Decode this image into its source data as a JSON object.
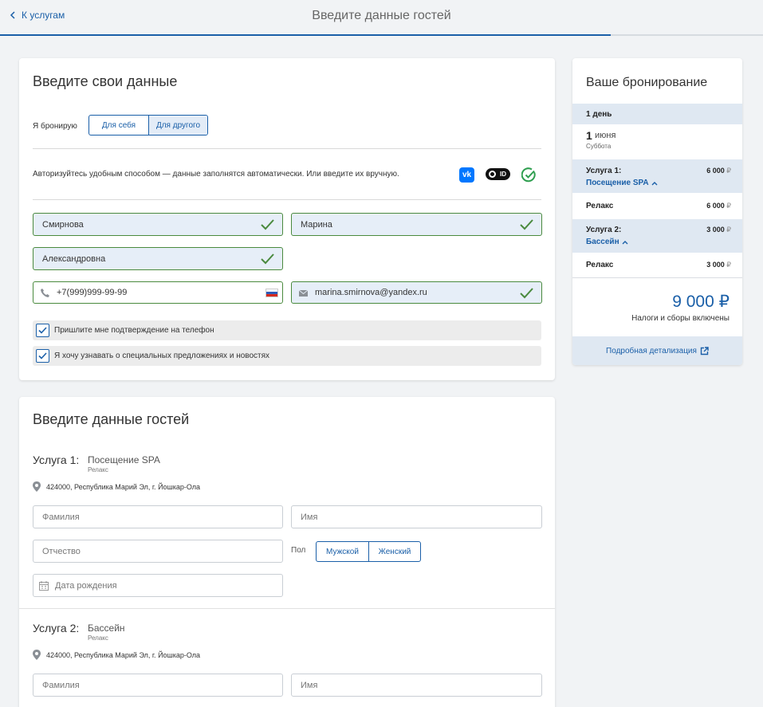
{
  "header": {
    "back_label": "К услугам",
    "title": "Введите данные гостей",
    "progress": 0.8
  },
  "own_data": {
    "title": "Введите свои данные",
    "booking_for_label": "Я бронирую",
    "booking_for_options": [
      "Для себя",
      "Для другого"
    ],
    "booking_for_selected": "Для другого",
    "auth_text": "Авторизуйтесь удобным способом — данные заполнятся автоматически. Или введите их вручную.",
    "auth_icons": [
      "vk-icon",
      "sber-id-icon",
      "check-circle-icon"
    ],
    "vk_label": "vk",
    "sber_label": "ID",
    "last_name": "Смирнова",
    "first_name": "Марина",
    "middle_name": "Александровна",
    "phone": "+7(999)999-99-99",
    "email": "marina.smirnova@yandex.ru",
    "checkboxes": [
      {
        "label": "Пришлите мне подтверждение на телефон",
        "checked": true
      },
      {
        "label": "Я хочу узнавать о специальных предложениях и новостях",
        "checked": true
      }
    ]
  },
  "guests": {
    "title": "Введите данные гостей",
    "services": [
      {
        "number_label": "Услуга 1:",
        "name": "Посещение SPA",
        "tariff": "Релакс",
        "address": "424000, Республика Марий Эл, г. Йошкар-Ола",
        "last_name_placeholder": "Фамилия",
        "first_name_placeholder": "Имя",
        "middle_name_placeholder": "Отчество",
        "gender_label": "Пол",
        "gender_options": [
          "Мужской",
          "Женский"
        ],
        "birthdate_placeholder": "Дата рождения"
      },
      {
        "number_label": "Услуга 2:",
        "name": "Бассейн",
        "tariff": "Релакс",
        "address": "424000, Республика Марий Эл, г. Йошкар-Ола",
        "last_name_placeholder": "Фамилия",
        "first_name_placeholder": "Имя"
      }
    ]
  },
  "summary": {
    "title": "Ваше бронирование",
    "day_label": "1 день",
    "date_day": "1",
    "date_month": "июня",
    "weekday": "Суббота",
    "items": [
      {
        "label": "Услуга 1:",
        "amount": "6 000",
        "link": "Посещение SPA",
        "tariff": "Релакс",
        "tariff_amount": "6 000"
      },
      {
        "label": "Услуга 2:",
        "amount": "3 000",
        "link": "Бассейн",
        "tariff": "Релакс",
        "tariff_amount": "3 000"
      }
    ],
    "currency": "₽",
    "total": "9 000",
    "tax_note": "Налоги и сборы включены",
    "details_link": "Подробная детализация"
  },
  "colors": {
    "accent": "#1a5fa8",
    "success": "#4a8a3e",
    "filled_bg": "#e6eef8",
    "page_bg": "#f1f3f5"
  }
}
